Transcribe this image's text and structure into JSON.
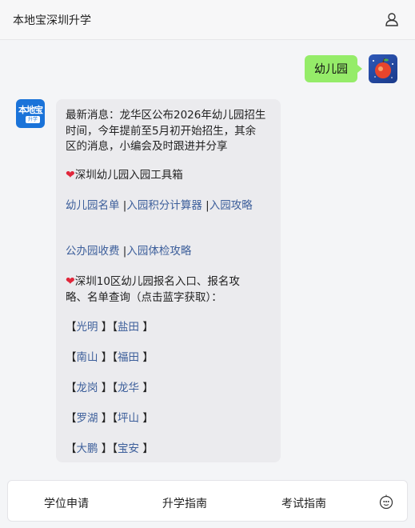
{
  "header": {
    "title": "本地宝深圳升学",
    "user_icon": "user-icon"
  },
  "user_message": {
    "text": "幼儿园"
  },
  "bot_message": {
    "intro_lines": [
      "最新消息：龙华区公布2026年幼儿园招生",
      "时间，今年提前至5月初开始招生，其余",
      "区的消息，小编会及时跟进并分享"
    ],
    "toolbox_title": "深圳幼儿园入园工具箱",
    "tool_links": [
      "幼儿园名单",
      "入园积分计算器",
      "入园攻略",
      "公办园收费",
      "入园体检攻略"
    ],
    "district_title_lines": [
      "深圳10区幼儿园报名入口、报名攻",
      "略、名单查询（点击蓝字获取）："
    ],
    "districts": [
      [
        "光明",
        "盐田"
      ],
      [
        "南山",
        "福田"
      ],
      [
        "龙岗",
        "龙华"
      ],
      [
        "罗湖",
        "坪山"
      ],
      [
        "大鹏",
        "宝安"
      ]
    ]
  },
  "bottom_bar": {
    "tabs": [
      "学位申请",
      "升学指南",
      "考试指南"
    ],
    "emoji_icon": "emoji-icon"
  },
  "bot_avatar_text": {
    "top": "本地宝",
    "bottom": "升学"
  },
  "colors": {
    "link": "#3d5f9b",
    "user_bubble": "#95ec69",
    "heart": "#e0263a",
    "brand": "#1a73d9"
  }
}
